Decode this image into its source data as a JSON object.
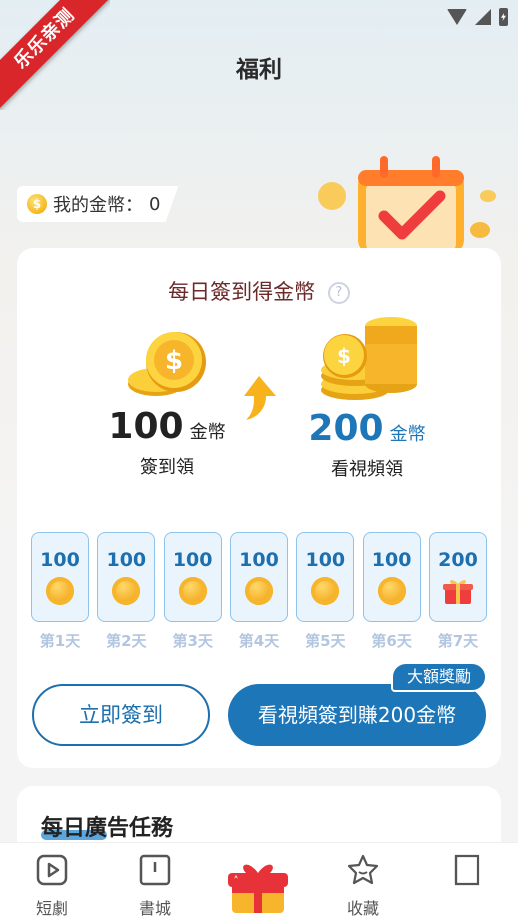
{
  "ribbon": {
    "text": "乐乐亲测"
  },
  "header": {
    "title": "福利"
  },
  "gold": {
    "label": "我的金幣：",
    "value": "0"
  },
  "checkin": {
    "title": "每日簽到得金幣",
    "help_icon": "?",
    "left": {
      "amount": "100",
      "unit": "金幣",
      "sub": "簽到領"
    },
    "right": {
      "amount": "200",
      "unit": "金幣",
      "sub": "看視頻領"
    },
    "days": [
      {
        "value": "100",
        "label": "第1天",
        "icon": "coin-icon"
      },
      {
        "value": "100",
        "label": "第2天",
        "icon": "coin-icon"
      },
      {
        "value": "100",
        "label": "第3天",
        "icon": "coin-icon"
      },
      {
        "value": "100",
        "label": "第4天",
        "icon": "coin-icon"
      },
      {
        "value": "100",
        "label": "第5天",
        "icon": "coin-icon"
      },
      {
        "value": "100",
        "label": "第6天",
        "icon": "coin-icon"
      },
      {
        "value": "200",
        "label": "第7天",
        "icon": "gift-icon"
      }
    ],
    "sign_button": "立即簽到",
    "video_button": "看視頻簽到賺200金幣",
    "bonus_tag": "大額獎勵"
  },
  "tasks": {
    "title": "每日廣告任務"
  },
  "nav": {
    "items": [
      {
        "label": "短劇",
        "icon": "play-icon"
      },
      {
        "label": "書城",
        "icon": "book-icon"
      },
      {
        "label": "",
        "icon": "gift-icon"
      },
      {
        "label": "收藏",
        "icon": "star-icon"
      },
      {
        "label": "",
        "icon": "bookmark-icon"
      }
    ]
  },
  "colors": {
    "accent": "#1d76b8",
    "ribbon": "#d9262b",
    "coin": "#f4b81f"
  }
}
